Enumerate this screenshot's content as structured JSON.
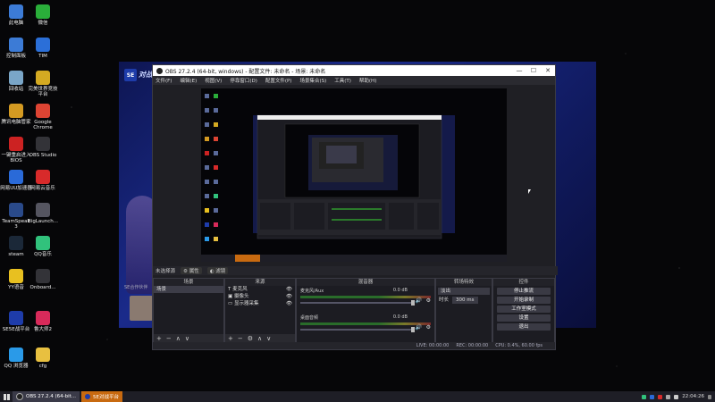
{
  "desktop": {
    "icons": [
      {
        "label": "此电脑",
        "icon": "computer-icon",
        "color": "#3c7bd6"
      },
      {
        "label": "微信",
        "icon": "wechat-icon",
        "color": "#2aae3a"
      },
      {
        "label": "控制面板",
        "icon": "control-panel-icon",
        "color": "#3c7bd6"
      },
      {
        "label": "TIM",
        "icon": "tim-icon",
        "color": "#2b6fd8"
      },
      {
        "label": "回收站",
        "icon": "recycle-bin-icon",
        "color": "#7aa6c8"
      },
      {
        "label": "完美世界竞技平台",
        "icon": "wanmei-icon",
        "color": "#d4aa22"
      },
      {
        "label": "腾讯电脑管家",
        "icon": "tencent-pc-manager-icon",
        "color": "#d49a22"
      },
      {
        "label": "Google Chrome",
        "icon": "chrome-icon",
        "color": "#dd4433"
      },
      {
        "label": "一键重启进入BIOS",
        "icon": "bios-icon",
        "color": "#cc2222"
      },
      {
        "label": "OBS Studio",
        "icon": "obs-icon",
        "color": "#333338"
      },
      {
        "label": "网易UU加速器",
        "icon": "uu-accelerator-icon",
        "color": "#2a6ad8"
      },
      {
        "label": "网易云音乐",
        "icon": "netease-music-icon",
        "color": "#d82a2a"
      },
      {
        "label": "TeamSpeak 3",
        "icon": "teamspeak-icon",
        "color": "#2a4a8a"
      },
      {
        "label": "BigLaunch...",
        "icon": "biglaunch-icon",
        "color": "#555560"
      },
      {
        "label": "steam",
        "icon": "steam-icon",
        "color": "#1b2838"
      },
      {
        "label": "QQ音乐",
        "icon": "qq-music-icon",
        "color": "#31c27c"
      },
      {
        "label": "YY语音",
        "icon": "yy-icon",
        "color": "#e8c020"
      },
      {
        "label": "Onboard...",
        "icon": "logitech-icon",
        "color": "#333338"
      },
      {
        "label": "SE5E战平台",
        "icon": "se-platform-icon",
        "color": "#1e3caa"
      },
      {
        "label": "鲁大师2",
        "icon": "ludashi-icon",
        "color": "#d82a5a"
      },
      {
        "label": "QQ 浏览器",
        "icon": "qq-browser-icon",
        "color": "#2a9ae8"
      },
      {
        "label": "cfg",
        "icon": "folder-icon",
        "color": "#e8c040"
      }
    ]
  },
  "background_app": {
    "logo_text": "SE",
    "brand": "对战平台",
    "bottom_text": "SE合作伙伴"
  },
  "obs": {
    "window_title": "OBS 27.2.4 (64-bit, windows) - 配置文件: 未命名 - 场景: 未命名",
    "window_buttons": {
      "minimize": "—",
      "maximize": "☐",
      "close": "✕"
    },
    "menu": [
      "文件(F)",
      "编辑(E)",
      "视图(V)",
      "停靠窗口(D)",
      "配置文件(P)",
      "场景集合(S)",
      "工具(T)",
      "帮助(H)"
    ],
    "source_bar": {
      "label": "未选择源",
      "properties": "属性",
      "filters": "滤镜"
    },
    "docks": {
      "scenes": {
        "title": "场景",
        "items": [
          "场景"
        ]
      },
      "sources": {
        "title": "来源",
        "items": [
          "麦克风",
          "摄像头",
          "显示器采集"
        ]
      },
      "mixer": {
        "title": "混音器",
        "tracks": [
          {
            "name": "麦克风/Aux",
            "db": "0.0 dB"
          },
          {
            "name": "桌面音频",
            "db": "0.0 dB"
          }
        ]
      },
      "transitions": {
        "title": "转场特效",
        "type": "淡出",
        "duration_label": "时长",
        "duration": "300 ms"
      },
      "controls": {
        "title": "控件",
        "buttons": [
          "停止推流",
          "开始录制",
          "工作室模式",
          "设置",
          "退出"
        ]
      }
    },
    "status": {
      "live": "LIVE: 00:00:00",
      "rec": "REC: 00:00:00",
      "cpu": "CPU: 0.4%, 60.00 fps",
      "fps": "CPU 0.4%, 60.00 fps"
    }
  },
  "taskbar": {
    "items": [
      {
        "label": "OBS 27.2.4 (64-bit...",
        "active": true
      },
      {
        "label": "5E对战平台",
        "active": false
      }
    ],
    "clock": "22:04:26"
  }
}
